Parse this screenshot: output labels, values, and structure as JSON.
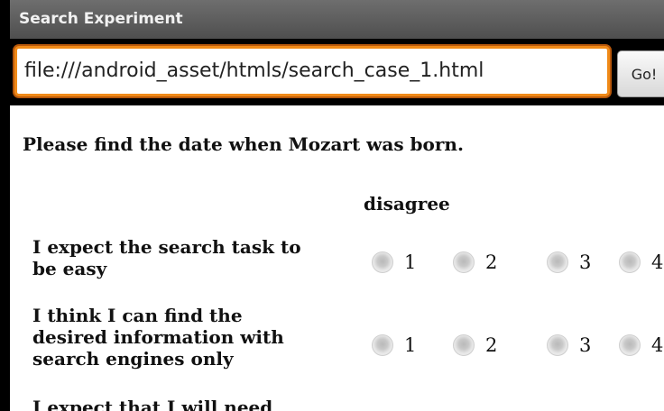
{
  "window": {
    "title": "Search Experiment"
  },
  "urlbar": {
    "value": "file:///android_asset/htmls/search_case_1.html",
    "go_label": "Go!"
  },
  "page": {
    "task": "Please find the date when Mozart was born.",
    "scale_header": "disagree",
    "questions": [
      {
        "line1": "I expect the search task to",
        "line2": "be easy",
        "line3": ""
      },
      {
        "line1": "I think I can find the",
        "line2": "desired information with",
        "line3": "search engines only"
      },
      {
        "line1": "I expect that I will need",
        "line2": "",
        "line3": ""
      }
    ],
    "options": [
      "1",
      "2",
      "3",
      "4"
    ]
  }
}
